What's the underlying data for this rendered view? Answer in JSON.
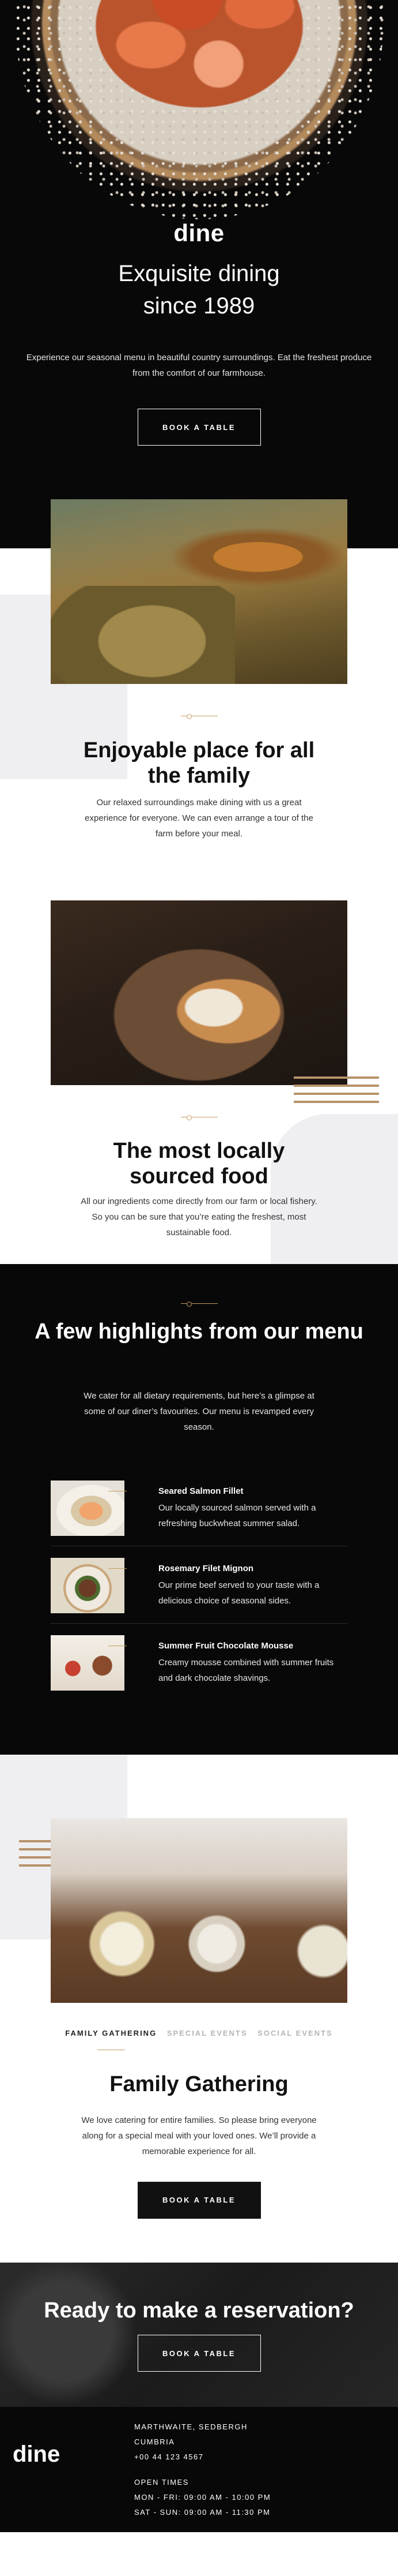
{
  "hero": {
    "logo": "dine",
    "title": "Exquisite dining since 1989",
    "description": "Experience our seasonal menu in beautiful country surroundings. Eat the freshest produce from the comfort of our farmhouse.",
    "button": "BOOK A TABLE"
  },
  "features": [
    {
      "title": "Enjoyable place for all the family",
      "text": "Our relaxed surroundings make dining with us a great experience for everyone. We can even arrange a tour of the farm before your meal."
    },
    {
      "title": "The most locally sourced food",
      "text": "All our ingredients come directly from our farm or local fishery. So you can be sure that you’re eating the freshest, most sustainable food."
    }
  ],
  "highlights": {
    "title": "A few highlights from our menu",
    "text": "We cater for all dietary requirements, but here’s a glimpse at some of our diner’s favourites. Our menu is revamped every season.",
    "items": [
      {
        "name": "Seared Salmon Fillet",
        "description": "Our locally sourced salmon served with a refreshing buckwheat summer salad."
      },
      {
        "name": "Rosemary Filet Mignon",
        "description": "Our prime beef served to your taste with a delicious choice of seasonal sides."
      },
      {
        "name": "Summer Fruit Chocolate Mousse",
        "description": "Creamy mousse combined with summer fruits and dark chocolate shavings."
      }
    ]
  },
  "events": {
    "tabs": [
      "FAMILY GATHERING",
      "SPECIAL EVENTS",
      "SOCIAL EVENTS"
    ],
    "active_tab": 0,
    "title": "Family Gathering",
    "text": "We love catering for entire families. So please bring everyone along for a special meal with your loved ones. We’ll provide a memorable experience for all.",
    "button": "BOOK A TABLE"
  },
  "cta": {
    "title": "Ready to make a reservation?",
    "button": "BOOK A TABLE"
  },
  "footer": {
    "logo": "dine",
    "address": [
      "MARTHWAITE, SEDBERGH",
      "CUMBRIA",
      "+00 44 123 4567"
    ],
    "hours_title": "OPEN TIMES",
    "hours": [
      "MON - FRI: 09:00 AM - 10:00 PM",
      "SAT - SUN: 09:00 AM - 11:30 PM"
    ]
  },
  "colors": {
    "accent": "#c59d5f",
    "dark": "#080808",
    "pattern_gray": "#efeff2"
  }
}
